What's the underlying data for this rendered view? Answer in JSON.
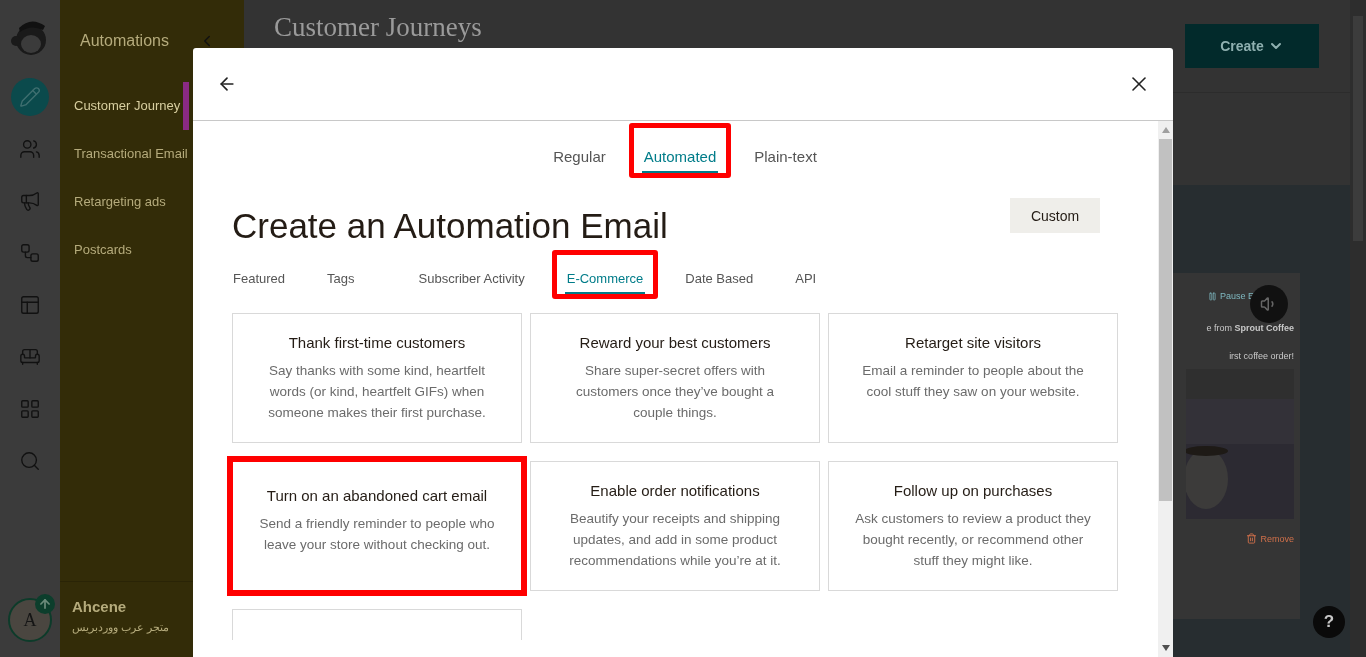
{
  "rail": {
    "items": [
      {
        "kind": "pencil",
        "selected": true
      },
      {
        "kind": "people",
        "selected": false
      },
      {
        "kind": "megaphone",
        "selected": false
      },
      {
        "kind": "flow",
        "selected": false
      },
      {
        "kind": "website",
        "selected": false
      },
      {
        "kind": "content",
        "selected": false
      },
      {
        "kind": "grid",
        "selected": false
      },
      {
        "kind": "search",
        "selected": false
      }
    ]
  },
  "submenu": {
    "title": "Automations",
    "items": [
      {
        "label": "Customer Journey",
        "selected": true
      },
      {
        "label": "Transactional Email",
        "selected": false
      },
      {
        "label": "Retargeting ads",
        "selected": false
      },
      {
        "label": "Postcards",
        "selected": false
      }
    ]
  },
  "account": {
    "initial": "A",
    "name": "Ahcene",
    "subtitle": "متجر عرب ووردبريس"
  },
  "page": {
    "title": "Customer Journeys",
    "create_button": "Create",
    "preview": {
      "pause": "Pause E",
      "sender_prefix": "e from ",
      "sender": "Sprout Coffee",
      "subject": "irst coffee order!",
      "remove": "Remove"
    }
  },
  "modal": {
    "type_tabs": [
      {
        "label": "Regular",
        "selected": false,
        "highlighted": false
      },
      {
        "label": "Automated",
        "selected": true,
        "highlighted": true
      },
      {
        "label": "Plain-text",
        "selected": false,
        "highlighted": false
      }
    ],
    "title": "Create an Automation Email",
    "custom_button": "Custom",
    "category_tabs": [
      {
        "label": "Featured",
        "selected": false,
        "highlighted": false
      },
      {
        "label": "Tags",
        "selected": false,
        "highlighted": false
      },
      {
        "label": "Subscriber Activity",
        "selected": false,
        "highlighted": false
      },
      {
        "label": "E-Commerce",
        "selected": true,
        "highlighted": true
      },
      {
        "label": "Date Based",
        "selected": false,
        "highlighted": false
      },
      {
        "label": "API",
        "selected": false,
        "highlighted": false
      }
    ],
    "cards": [
      {
        "kind": "full",
        "title": "Thank first-time customers",
        "description": "Say thanks with some kind, heartfelt words (or kind, heartfelt GIFs) when someone makes their first purchase.",
        "highlighted": false
      },
      {
        "kind": "full",
        "title": "Reward your best customers",
        "description": "Share super-secret offers with customers once they’ve bought a couple things.",
        "highlighted": false
      },
      {
        "kind": "full",
        "title": "Retarget site visitors",
        "description": "Email a reminder to people about the cool stuff they saw on your website.",
        "highlighted": false
      },
      {
        "kind": "full",
        "title": "Turn on an abandoned cart email",
        "description": "Send a friendly reminder to people who leave your store without checking out.",
        "highlighted": true
      },
      {
        "kind": "full",
        "title": "Enable order notifications",
        "description": "Beautify your receipts and shipping updates, and add in some product recommendations while you’re at it.",
        "highlighted": false
      },
      {
        "kind": "full",
        "title": "Follow up on purchases",
        "description": "Ask customers to review a product they bought recently, or recommend other stuff they might like.",
        "highlighted": false
      },
      {
        "kind": "cut",
        "highlighted": false
      }
    ]
  },
  "help_button": "?"
}
